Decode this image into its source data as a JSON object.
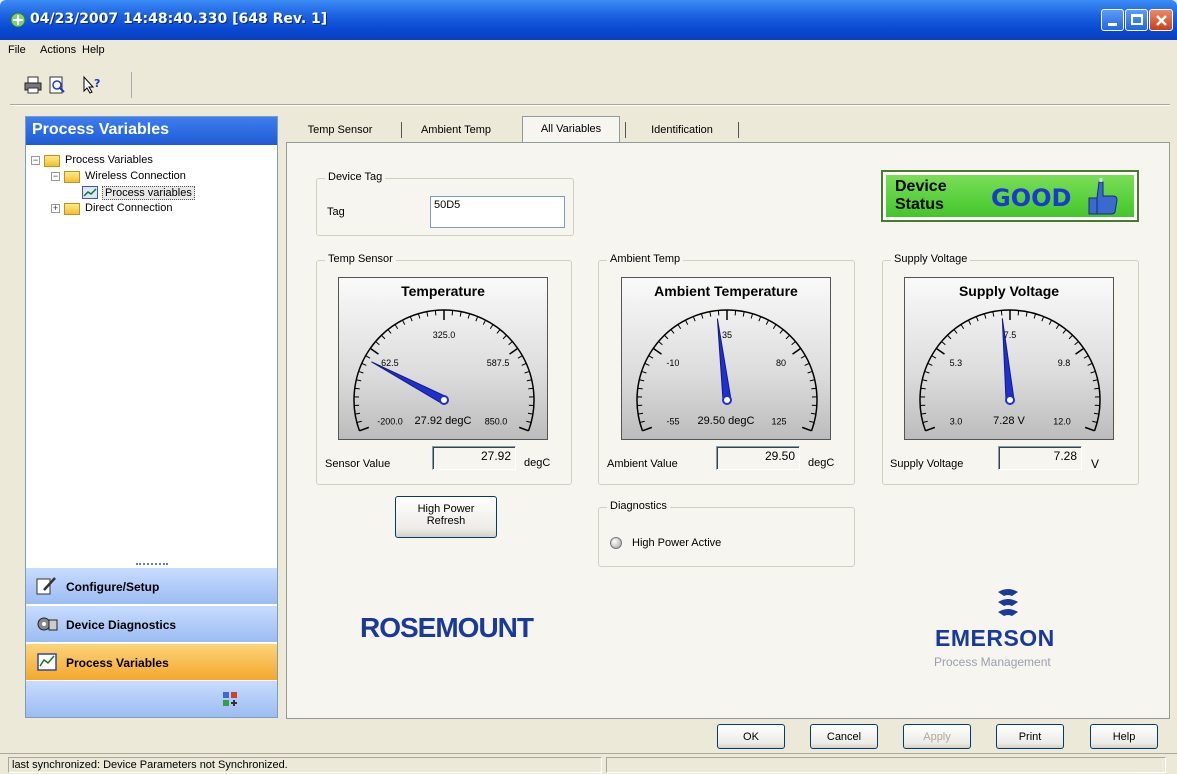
{
  "window": {
    "title": "04/23/2007 14:48:40.330 [648 Rev. 1]"
  },
  "menu": [
    "File",
    "Actions",
    "Help"
  ],
  "toolbar": {
    "icons": [
      "print-icon",
      "print-preview-icon",
      "context-help-icon"
    ]
  },
  "left_panel": {
    "header": "Process Variables",
    "tree": [
      {
        "label": "Process Variables",
        "expander": "−"
      },
      {
        "label": "Wireless Connection",
        "expander": "−"
      },
      {
        "label": "Process variables",
        "selected": true
      },
      {
        "label": "Direct Connection",
        "expander": "+"
      }
    ],
    "nav": [
      {
        "label": "Configure/Setup"
      },
      {
        "label": "Device Diagnostics"
      },
      {
        "label": "Process Variables",
        "active": true
      }
    ]
  },
  "tabs": [
    "Temp Sensor",
    "Ambient Temp",
    "All Variables",
    "Identification"
  ],
  "active_tab": "All Variables",
  "device_tag": {
    "group": "Device Tag",
    "label": "Tag",
    "value": "50D5"
  },
  "device_status": {
    "label_line1": "Device",
    "label_line2": "Status",
    "value": "GOOD",
    "color": "#3fc428"
  },
  "temp_sensor": {
    "group": "Temp Sensor",
    "gauge_title": "Temperature",
    "ticks": [
      "-200.0",
      "62.5",
      "325.0",
      "587.5",
      "850.0"
    ],
    "readout": "27.92 degC",
    "value_label": "Sensor Value",
    "value": "27.92",
    "unit": "degC",
    "min": -200,
    "max": 850,
    "current": 27.92
  },
  "ambient_temp": {
    "group": "Ambient Temp",
    "gauge_title": "Ambient Temperature",
    "ticks": [
      "-55",
      "-10",
      "35",
      "80",
      "125"
    ],
    "readout": "29.50 degC",
    "value_label": "Ambient Value",
    "value": "29.50",
    "unit": "degC",
    "min": -55,
    "max": 125,
    "current": 29.5
  },
  "supply_voltage": {
    "group": "Supply Voltage",
    "gauge_title": "Supply Voltage",
    "ticks": [
      "3.0",
      "5.3",
      "7.5",
      "9.8",
      "12.0"
    ],
    "readout": "7.28 V",
    "value_label": "Supply Voltage",
    "value": "7.28",
    "unit": "V",
    "min": 3.0,
    "max": 12.0,
    "current": 7.28
  },
  "high_power_button": {
    "line1": "High Power",
    "line2": "Refresh"
  },
  "diagnostics": {
    "group": "Diagnostics",
    "item": "High Power Active"
  },
  "logos": {
    "rosemount": "ROSEMOUNT",
    "emerson": "EMERSON",
    "emerson_sub": "Process Management"
  },
  "buttons": {
    "ok": "OK",
    "cancel": "Cancel",
    "apply": "Apply",
    "print": "Print",
    "help": "Help"
  },
  "statusbar": {
    "text": "last synchronized: Device Parameters not Synchronized."
  }
}
